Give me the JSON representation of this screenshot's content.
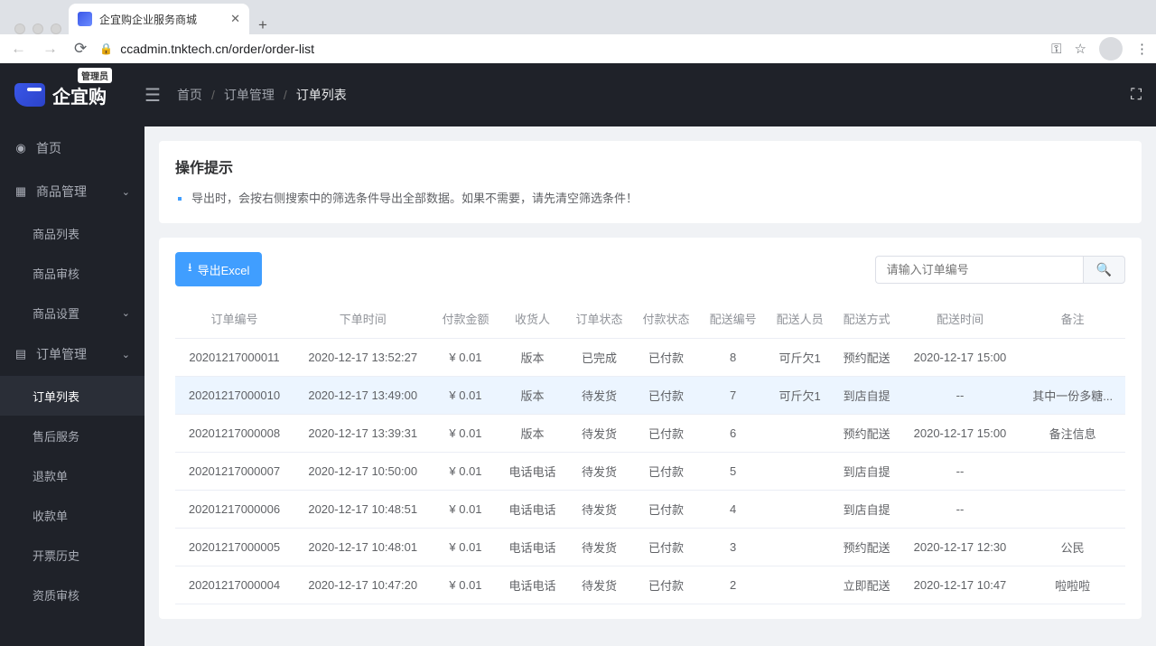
{
  "browser": {
    "tab_title": "企宜购企业服务商城",
    "url": "ccadmin.tnktech.cn/order/order-list"
  },
  "header": {
    "logo_text": "企宜购",
    "logo_badge": "管理员",
    "breadcrumb": {
      "home": "首页",
      "section": "订单管理",
      "current": "订单列表"
    }
  },
  "sidebar": {
    "home": "首页",
    "goods": {
      "label": "商品管理",
      "items": [
        "商品列表",
        "商品审核",
        "商品设置"
      ]
    },
    "order": {
      "label": "订单管理",
      "items": [
        "订单列表",
        "售后服务",
        "退款单",
        "收款单",
        "开票历史",
        "资质审核"
      ]
    }
  },
  "tips": {
    "title": "操作提示",
    "items": [
      "导出时，会按右侧搜索中的筛选条件导出全部数据。如果不需要，请先清空筛选条件！"
    ]
  },
  "toolbar": {
    "export_label": "导出Excel",
    "search_placeholder": "请输入订单编号"
  },
  "table": {
    "headers": [
      "订单编号",
      "下单时间",
      "付款金额",
      "收货人",
      "订单状态",
      "付款状态",
      "配送编号",
      "配送人员",
      "配送方式",
      "配送时间",
      "备注"
    ],
    "rows": [
      [
        "20201217000011",
        "2020-12-17 13:52:27",
        "¥ 0.01",
        "版本",
        "已完成",
        "已付款",
        "8",
        "可斤欠1",
        "预约配送",
        "2020-12-17 15:00",
        ""
      ],
      [
        "20201217000010",
        "2020-12-17 13:49:00",
        "¥ 0.01",
        "版本",
        "待发货",
        "已付款",
        "7",
        "可斤欠1",
        "到店自提",
        "--",
        "其中一份多糖..."
      ],
      [
        "20201217000008",
        "2020-12-17 13:39:31",
        "¥ 0.01",
        "版本",
        "待发货",
        "已付款",
        "6",
        "",
        "预约配送",
        "2020-12-17 15:00",
        "备注信息"
      ],
      [
        "20201217000007",
        "2020-12-17 10:50:00",
        "¥ 0.01",
        "电话电话",
        "待发货",
        "已付款",
        "5",
        "",
        "到店自提",
        "--",
        ""
      ],
      [
        "20201217000006",
        "2020-12-17 10:48:51",
        "¥ 0.01",
        "电话电话",
        "待发货",
        "已付款",
        "4",
        "",
        "到店自提",
        "--",
        ""
      ],
      [
        "20201217000005",
        "2020-12-17 10:48:01",
        "¥ 0.01",
        "电话电话",
        "待发货",
        "已付款",
        "3",
        "",
        "预约配送",
        "2020-12-17 12:30",
        "公民"
      ],
      [
        "20201217000004",
        "2020-12-17 10:47:20",
        "¥ 0.01",
        "电话电话",
        "待发货",
        "已付款",
        "2",
        "",
        "立即配送",
        "2020-12-17 10:47",
        "啦啦啦"
      ]
    ]
  }
}
